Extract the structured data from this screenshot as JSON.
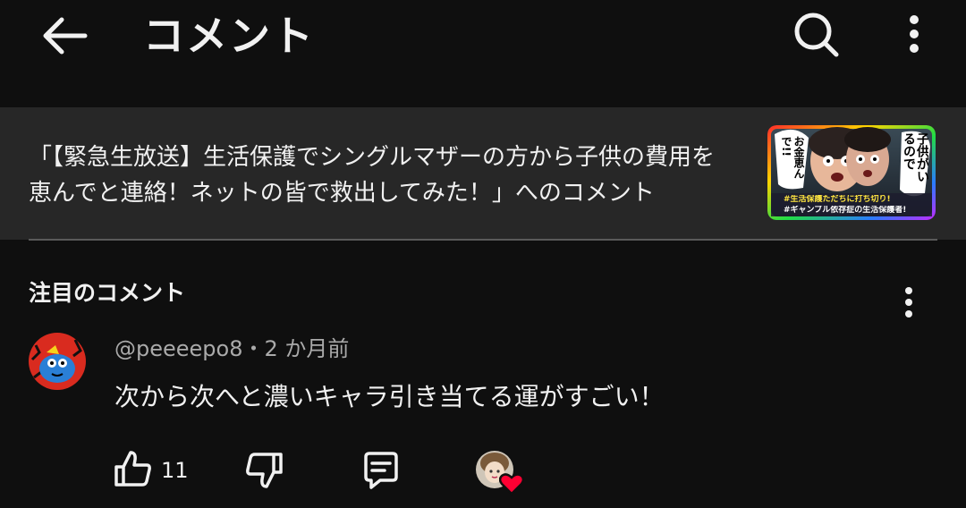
{
  "header": {
    "title": "コメント",
    "icons": {
      "back": "arrow-left-icon",
      "search": "search-icon",
      "more": "more-vertical-icon"
    }
  },
  "video": {
    "title_line1": "「【緊急生放送】生活保護でシングルマザーの方から子供の費用を",
    "title_line2": "恵んでと連絡！ネットの皆で救出してみた！」へのコメント",
    "thumbnail": {
      "caption_main": "子供がいるので",
      "caption_side": "お金恵んで!!",
      "caption_bottom1": "#生活保護ただちに打ち切り!",
      "caption_bottom2": "#ギャンブル依存症の生活保護者!"
    }
  },
  "section": {
    "title": "注目のコメント"
  },
  "comment": {
    "author": "@peeeepo8",
    "separator": "・",
    "time": "2 か月前",
    "text": "次から次へと濃いキャラ引き当てる運がすごい！",
    "likes": "11"
  },
  "colors": {
    "background": "#0f0f0f",
    "card": "#272727",
    "meta": "#aaaaaa",
    "heart": "#ff0033"
  }
}
